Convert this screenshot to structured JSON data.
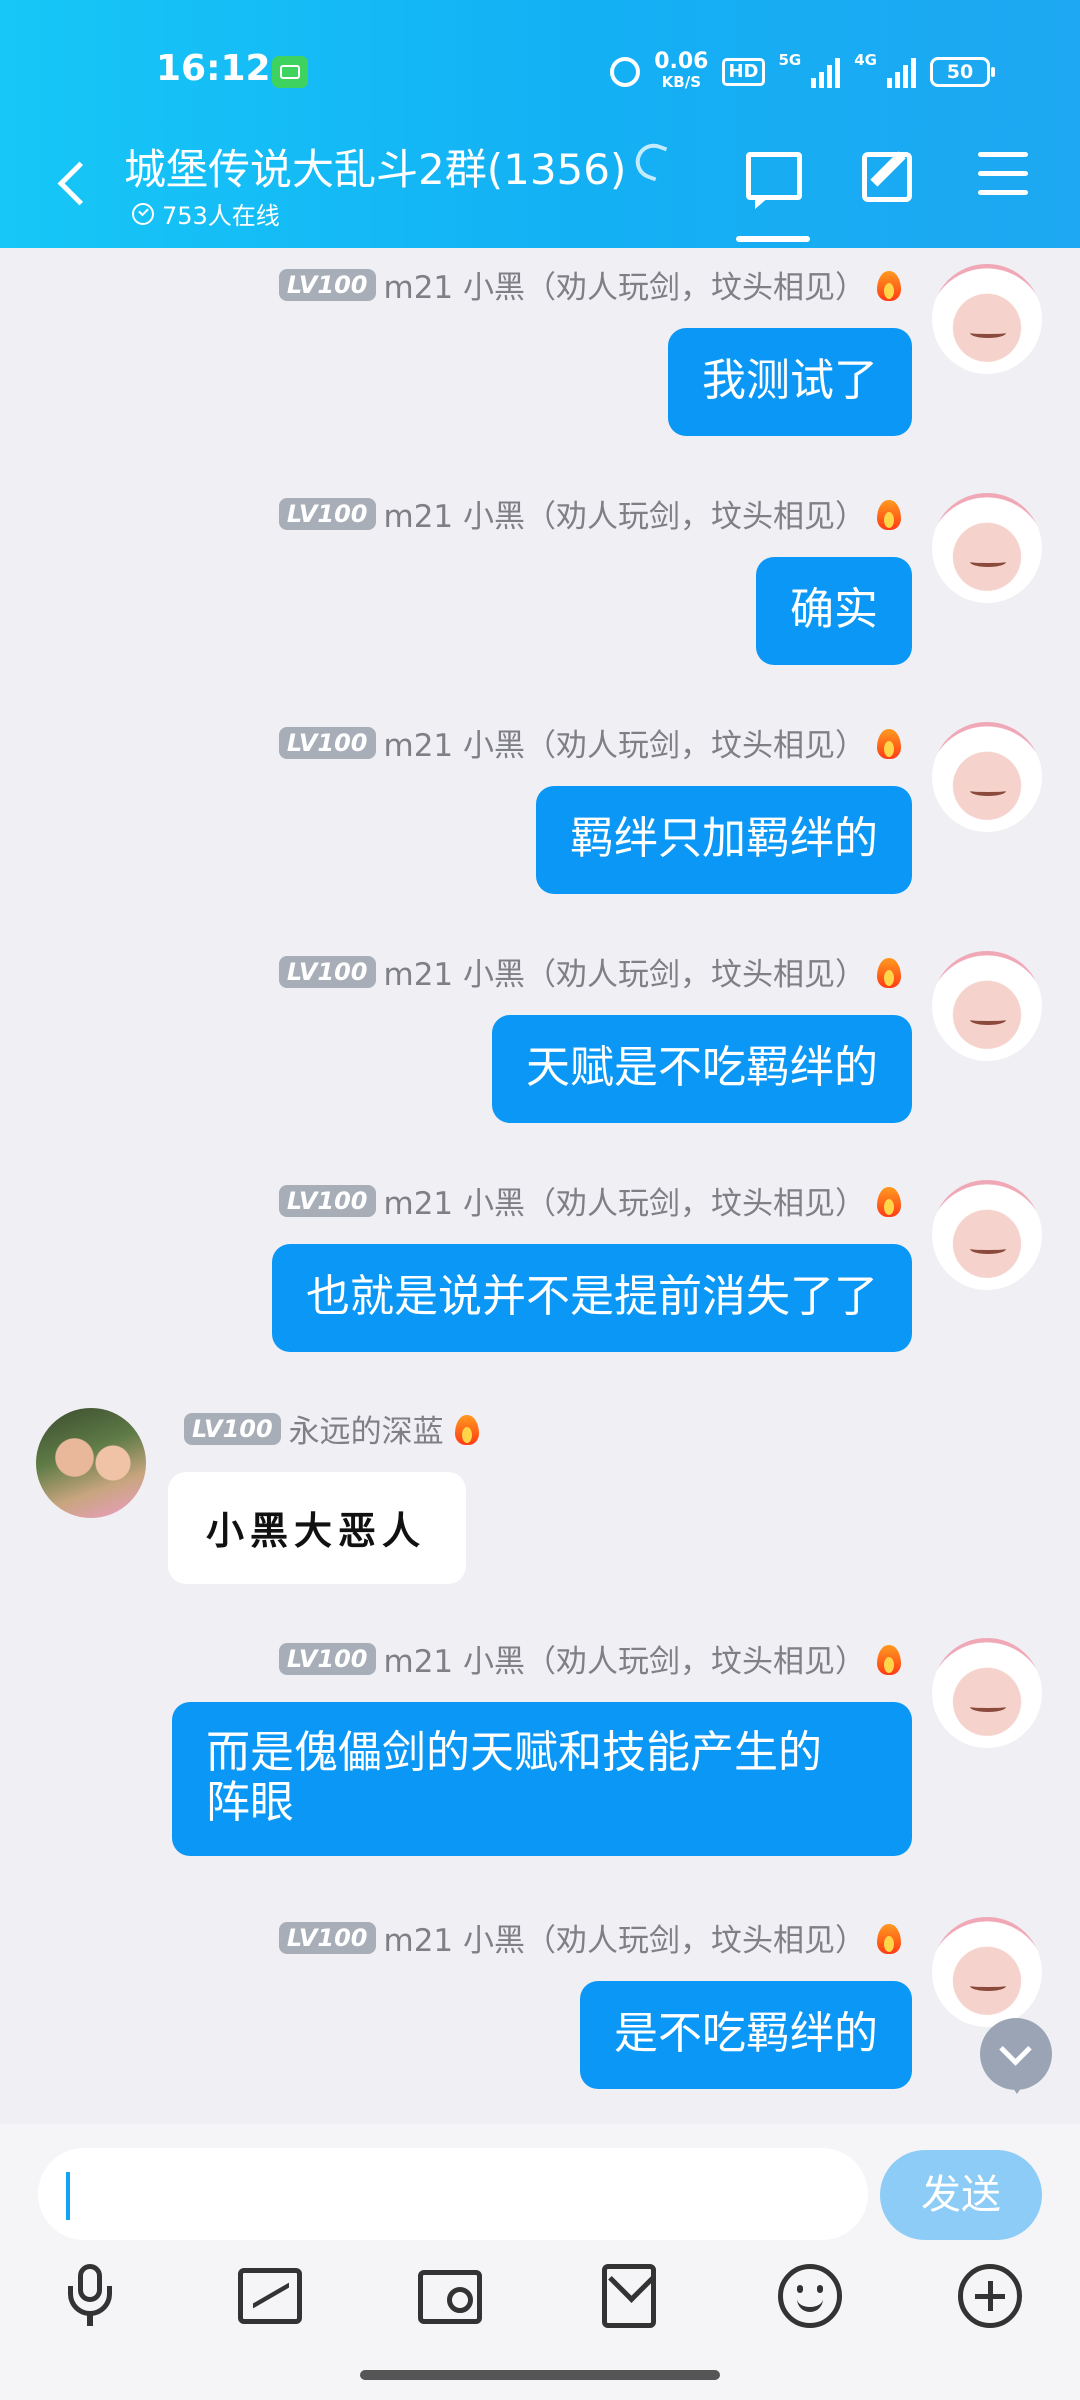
{
  "status_bar": {
    "time": "16:12",
    "net_speed": "0.06",
    "net_unit": "KB/S",
    "hd": "HD",
    "sig1_tag": "5G",
    "sig2_tag": "4G",
    "battery": "50"
  },
  "header": {
    "title": "城堡传说大乱斗2群(1356)",
    "online": "753人在线"
  },
  "messages": [
    {
      "side": "right",
      "level": "LV100",
      "sender": "m21 小黑（劝人玩剑，坟头相见）",
      "text": "我测试了"
    },
    {
      "side": "right",
      "level": "LV100",
      "sender": "m21 小黑（劝人玩剑，坟头相见）",
      "text": "确实"
    },
    {
      "side": "right",
      "level": "LV100",
      "sender": "m21 小黑（劝人玩剑，坟头相见）",
      "text": "羁绊只加羁绊的"
    },
    {
      "side": "right",
      "level": "LV100",
      "sender": "m21 小黑（劝人玩剑，坟头相见）",
      "text": "天赋是不吃羁绊的"
    },
    {
      "side": "right",
      "level": "LV100",
      "sender": "m21 小黑（劝人玩剑，坟头相见）",
      "text": "也就是说并不是提前消失了了"
    },
    {
      "side": "left",
      "level": "LV100",
      "sender": "永远的深蓝",
      "text": "小黑大恶人"
    },
    {
      "side": "right",
      "level": "LV100",
      "sender": "m21 小黑（劝人玩剑，坟头相见）",
      "text_line1": "而是傀儡剑的天赋和技能产生的",
      "text_line2": "阵眼"
    },
    {
      "side": "right",
      "level": "LV100",
      "sender": "m21 小黑（劝人玩剑，坟头相见）",
      "text": "是不吃羁绊的"
    }
  ],
  "input": {
    "value": "",
    "send_label": "发送"
  },
  "colors": {
    "header_bg": "#13b0f4",
    "bubble_self": "#0a97f5",
    "chat_bg": "#efeff4",
    "send_button": "#8cccf6"
  },
  "icons": [
    "back-icon",
    "listen-icon",
    "chat-icon",
    "edit-icon",
    "menu-icon",
    "fire-icon",
    "scroll-down-icon",
    "mic-icon",
    "image-icon",
    "camera-icon",
    "red-packet-icon",
    "emoji-icon",
    "plus-icon"
  ]
}
